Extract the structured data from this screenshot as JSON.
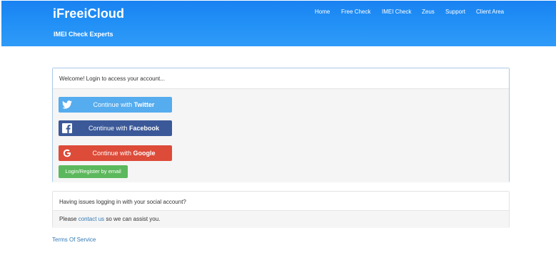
{
  "header": {
    "brand": "iFreeiCloud",
    "tagline": "IMEI Check Experts",
    "nav": [
      "Home",
      "Free Check",
      "IMEI Check",
      "Zeus",
      "Support",
      "Client Area"
    ]
  },
  "login": {
    "welcome": "Welcome! Login to access your account...",
    "continue_prefix": "Continue with ",
    "twitter": "Twitter",
    "facebook": "Facebook",
    "google": "Google",
    "email_button": "Login/Register by email"
  },
  "help": {
    "question": "Having issues logging in with your social account?",
    "please": "Please ",
    "contact_link": "contact us",
    "assist": " so we can assist you."
  },
  "footer": {
    "terms": "Terms Of Service"
  },
  "colors": {
    "header": "#1f8ef5",
    "twitter": "#55acee",
    "facebook": "#3b5998",
    "google": "#dd4b39",
    "email": "#5cb85c",
    "link": "#337ab7"
  },
  "icons": {
    "twitter": "twitter-bird-icon",
    "facebook": "facebook-f-icon",
    "google": "google-g-icon"
  }
}
